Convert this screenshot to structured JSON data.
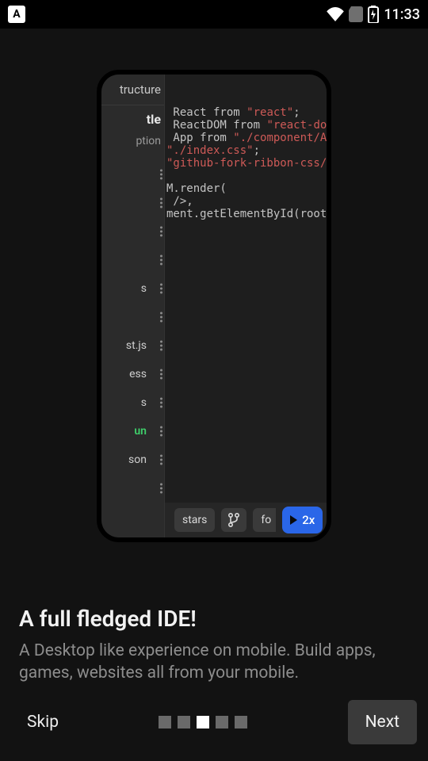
{
  "status": {
    "keyboard_badge": "A",
    "time": "11:33"
  },
  "device": {
    "sidebar": {
      "header": "tructure",
      "title": "tle",
      "desc": "ption",
      "files": [
        {
          "label": "",
          "green": false
        },
        {
          "label": "",
          "green": false
        },
        {
          "label": "",
          "green": false
        },
        {
          "label": "",
          "green": false
        },
        {
          "label": "s",
          "green": false
        },
        {
          "label": "",
          "green": false
        },
        {
          "label": "st.js",
          "green": false
        },
        {
          "label": "ess",
          "green": false
        },
        {
          "label": "s",
          "green": false
        },
        {
          "label": "un",
          "green": true
        },
        {
          "label": "son",
          "green": false
        },
        {
          "label": "",
          "green": false
        }
      ]
    },
    "editor": {
      "l1a": " React from ",
      "l1s": "\"react\"",
      "l1b": ";",
      "l2a": " ReactDOM from ",
      "l2s": "\"react-dom",
      "l3a": " App from ",
      "l3s": "\"./component/Ap",
      "l4s": "\"./index.css\"",
      "l4b": ";",
      "l5s": "\"github-fork-ribbon-css/",
      "l6": "",
      "l7": "M.render(",
      "l8": " />,",
      "l9": "ment.getElementById(root"
    },
    "bottombar": {
      "chip1": "stars",
      "chip2": "fo",
      "run_label": "2x"
    }
  },
  "onboarding": {
    "title": "A full fledged IDE!",
    "subtitle": "A Desktop like experience on mobile. Build apps, games, websites all from your mobile.",
    "skip": "Skip",
    "next": "Next",
    "page_count": 5,
    "active_index": 2
  }
}
